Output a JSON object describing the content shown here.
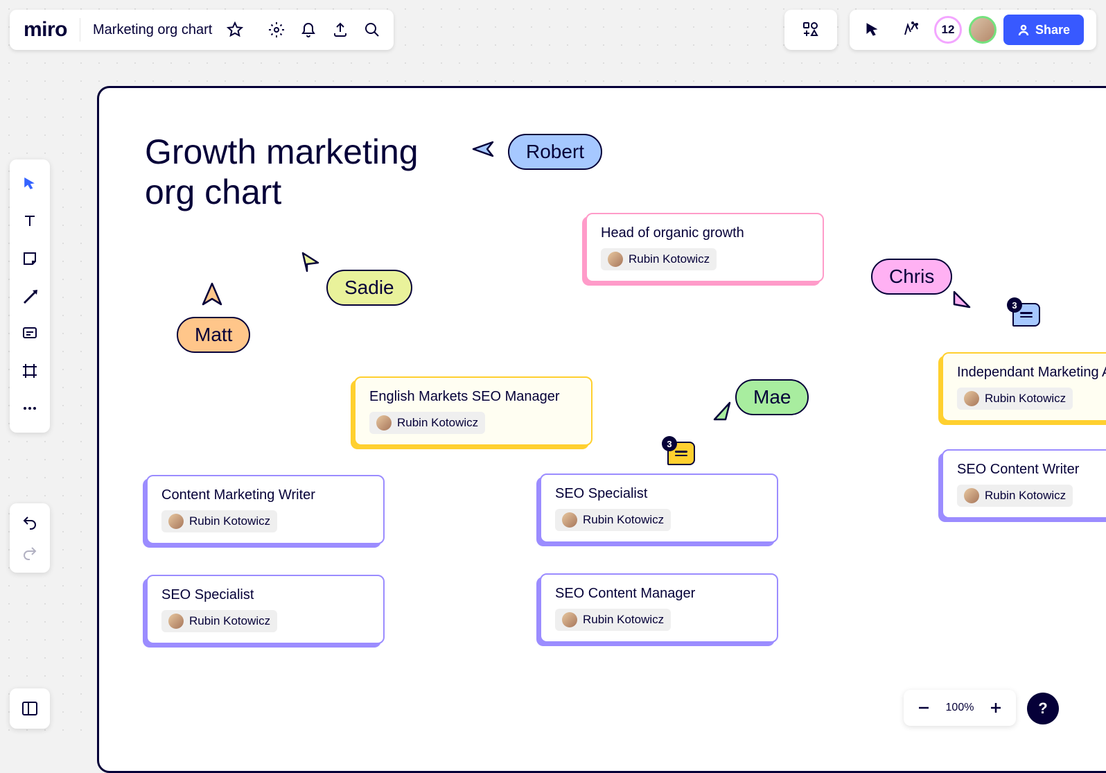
{
  "header": {
    "logo_text": "miro",
    "board_title": "Marketing org chart",
    "participant_count": "12",
    "share_label": "Share"
  },
  "zoom": {
    "level": "100%"
  },
  "frame": {
    "title": "Growth marketing org chart"
  },
  "collaborators": {
    "robert": "Robert",
    "sadie": "Sadie",
    "matt": "Matt",
    "chris": "Chris",
    "mae": "Mae"
  },
  "comments": {
    "yellow_count": "3",
    "blue_count": "3"
  },
  "nodes": {
    "head": {
      "role": "Head of organic growth",
      "person": "Rubin Kotowicz"
    },
    "english_seo_mgr": {
      "role": "English Markets SEO Manager",
      "person": "Rubin Kotowicz"
    },
    "content_writer": {
      "role": "Content Marketing Writer",
      "person": "Rubin Kotowicz"
    },
    "seo_specialist_1": {
      "role": "SEO Specialist",
      "person": "Rubin Kotowicz"
    },
    "seo_specialist_2": {
      "role": "SEO Specialist",
      "person": "Rubin Kotowicz"
    },
    "seo_content_mgr": {
      "role": "SEO Content Manager",
      "person": "Rubin Kotowicz"
    },
    "ind_marketing": {
      "role": "Independant Marketing Analyst",
      "person": "Rubin Kotowicz"
    },
    "seo_content_writer": {
      "role": "SEO Content Writer",
      "person": "Rubin Kotowicz"
    }
  },
  "colors": {
    "pink": "#ff9bc9",
    "yellow": "#ffd02f",
    "purple": "#9b8cff",
    "robert_bg": "#a6c8ff",
    "sadie_bg": "#e9f29b",
    "matt_bg": "#ffc68a",
    "chris_bg": "#ffb1f3",
    "mae_bg": "#a8ed9f"
  },
  "help_label": "?"
}
